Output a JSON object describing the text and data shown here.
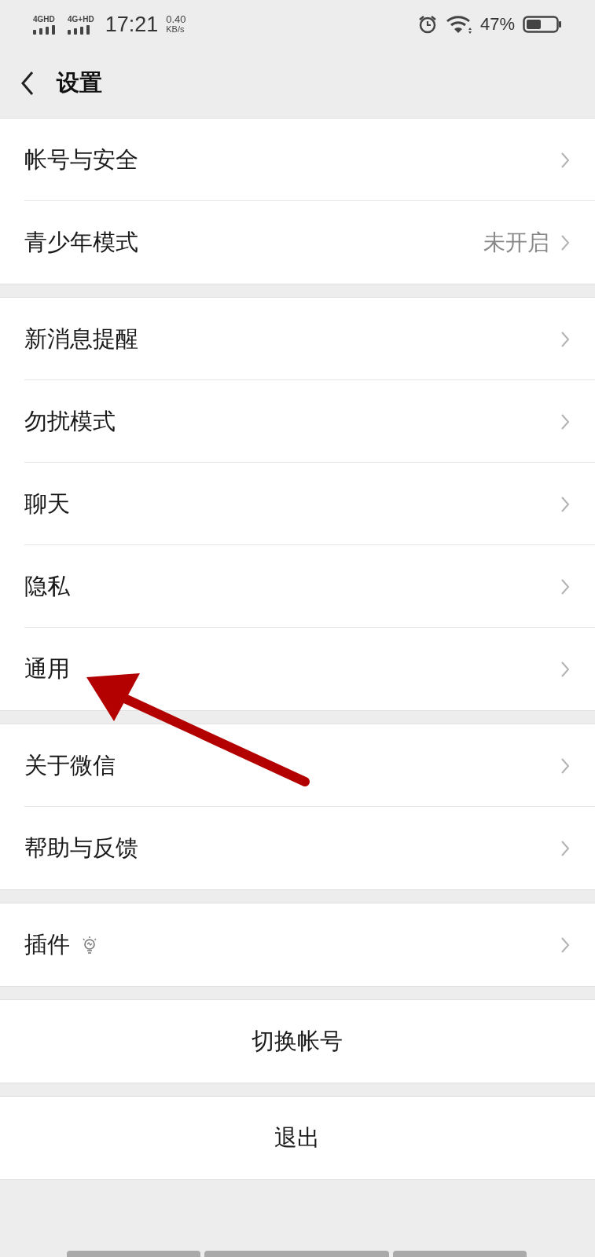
{
  "status_bar": {
    "networks": [
      "4GHD",
      "4G+HD"
    ],
    "time": "17:21",
    "speed": "0.40",
    "speed_unit": "KB/s",
    "battery": "47%"
  },
  "header": {
    "title": "设置"
  },
  "groups": [
    {
      "items": [
        {
          "kind": "link",
          "label": "帐号与安全"
        },
        {
          "kind": "link",
          "label": "青少年模式",
          "value": "未开启"
        }
      ]
    },
    {
      "items": [
        {
          "kind": "link",
          "label": "新消息提醒"
        },
        {
          "kind": "link",
          "label": "勿扰模式"
        },
        {
          "kind": "link",
          "label": "聊天"
        },
        {
          "kind": "link",
          "label": "隐私"
        },
        {
          "kind": "link",
          "label": "通用"
        }
      ]
    },
    {
      "items": [
        {
          "kind": "link",
          "label": "关于微信"
        },
        {
          "kind": "link",
          "label": "帮助与反馈"
        }
      ]
    },
    {
      "items": [
        {
          "kind": "link",
          "label": "插件",
          "bulb": true
        }
      ]
    },
    {
      "items": [
        {
          "kind": "action",
          "label": "切换帐号"
        }
      ]
    },
    {
      "items": [
        {
          "kind": "action",
          "label": "退出"
        }
      ]
    }
  ]
}
